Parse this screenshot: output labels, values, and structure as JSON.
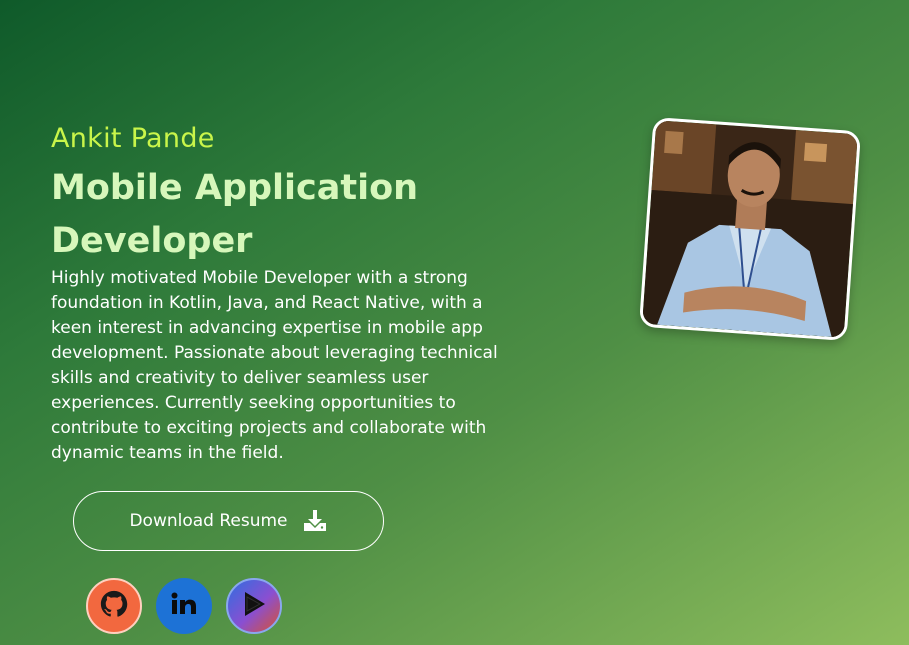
{
  "profile": {
    "name": "Ankit Pande",
    "title": "Mobile Application Developer",
    "description": "Highly motivated Mobile Developer with a strong foundation in Kotlin, Java, and React Native, with a keen interest in advancing expertise in mobile app development. Passionate about leveraging technical skills and creativity to deliver seamless user experiences. Currently seeking opportunities to contribute to exciting projects and collaborate with dynamic teams in the field."
  },
  "actions": {
    "download_label": "Download Resume",
    "download_icon": "download-icon"
  },
  "socials": [
    {
      "name": "github",
      "icon": "github-icon",
      "color": "#f2683f"
    },
    {
      "name": "linkedin",
      "icon": "linkedin-icon",
      "label": "in",
      "color": "#1d72d6"
    },
    {
      "name": "google-play",
      "icon": "play-store-icon",
      "color": "#5b5fd8"
    }
  ],
  "colors": {
    "name_accent": "#c9f54a",
    "title_accent": "#d7f7bb",
    "background_start": "#0f5a2a",
    "background_end": "#8ebd5d"
  }
}
